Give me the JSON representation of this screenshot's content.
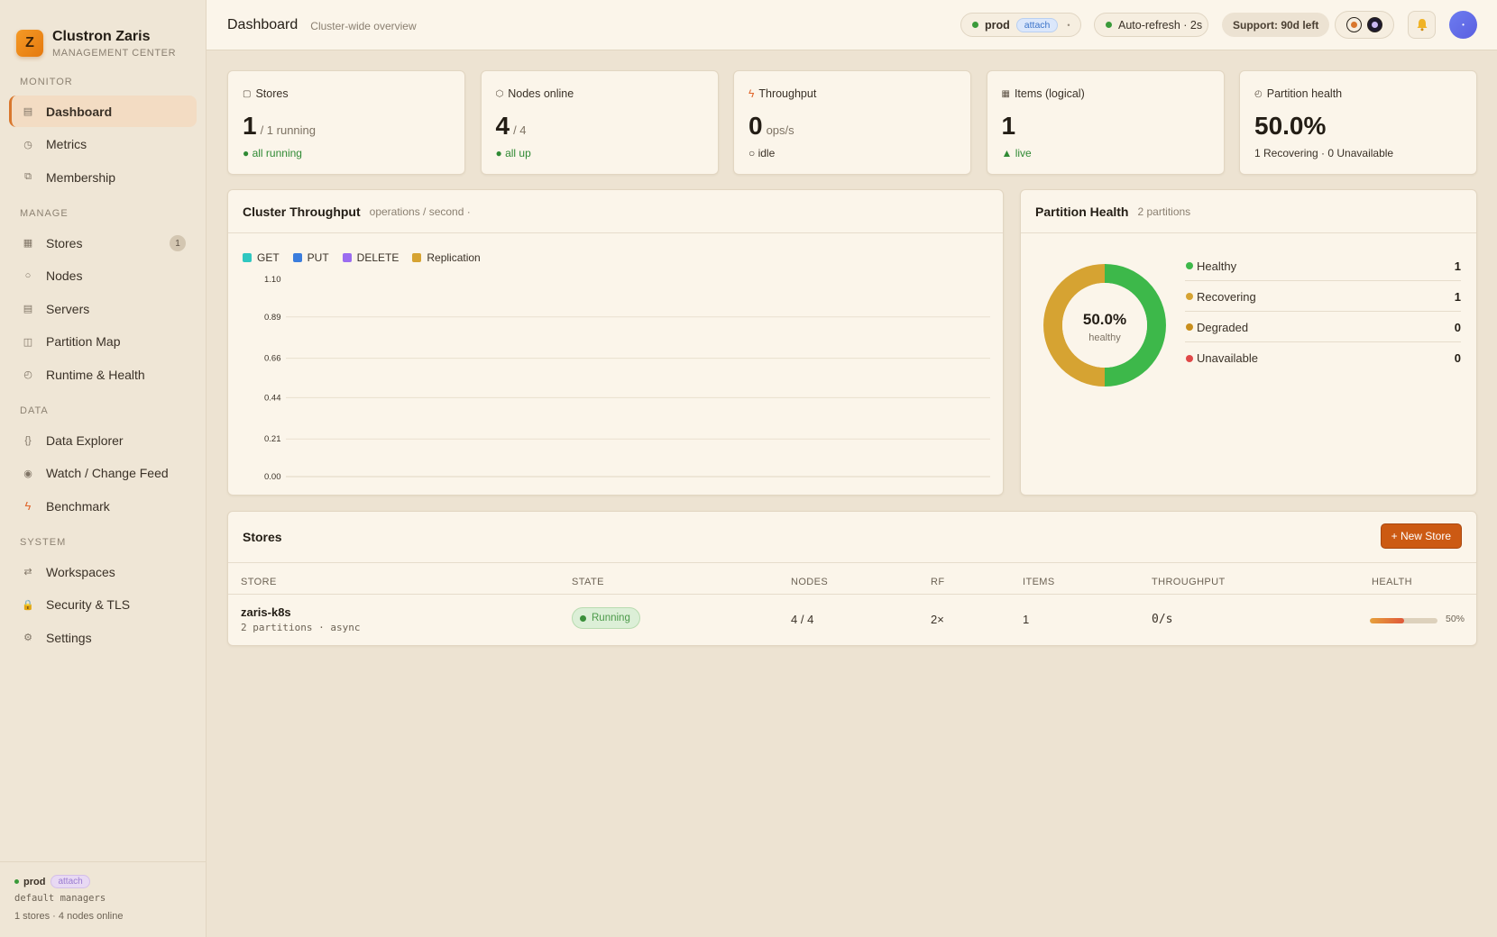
{
  "brand": {
    "logo": "Z",
    "name": "Clustron Zaris",
    "subtitle": "MANAGEMENT CENTER"
  },
  "sidebar": {
    "sections": [
      {
        "label": "MONITOR",
        "items": [
          {
            "label": "Dashboard",
            "icon": "grid-icon",
            "active": true
          },
          {
            "label": "Metrics",
            "icon": "gauge-icon"
          },
          {
            "label": "Membership",
            "icon": "people-icon"
          }
        ]
      },
      {
        "label": "MANAGE",
        "items": [
          {
            "label": "Stores",
            "icon": "database-icon",
            "badge": "1"
          },
          {
            "label": "Nodes",
            "icon": "node-icon"
          },
          {
            "label": "Servers",
            "icon": "server-icon"
          },
          {
            "label": "Partition Map",
            "icon": "map-icon"
          },
          {
            "label": "Runtime & Health",
            "icon": "heartbeat-icon"
          }
        ]
      },
      {
        "label": "DATA",
        "items": [
          {
            "label": "Data Explorer",
            "icon": "braces-icon"
          },
          {
            "label": "Watch / Change Feed",
            "icon": "eye-icon"
          },
          {
            "label": "Benchmark",
            "icon": "bolt-icon"
          }
        ]
      },
      {
        "label": "SYSTEM",
        "items": [
          {
            "label": "Workspaces",
            "icon": "swap-icon"
          },
          {
            "label": "Security & TLS",
            "icon": "lock-icon"
          },
          {
            "label": "Settings",
            "icon": "gear-icon"
          }
        ]
      }
    ],
    "footer": {
      "env": "prod",
      "attach": "attach",
      "workspace": "default managers",
      "summary": "1 stores · 4 nodes online"
    }
  },
  "header": {
    "title": "Dashboard",
    "subtitle": "Cluster-wide overview",
    "env": "prod",
    "attach": "attach",
    "env_caret": "•",
    "autorefresh": "Auto-refresh · 2s",
    "support": "Support: 90d left",
    "avatar": "•"
  },
  "stats": [
    {
      "label": "Stores",
      "icon": "square-icon",
      "value": "1",
      "suffix": "/ 1 running",
      "foot": "● all running",
      "foot_status": "green"
    },
    {
      "label": "Nodes online",
      "icon": "hexagon-icon",
      "value": "4",
      "suffix": "/ 4",
      "foot": "● all up",
      "foot_status": "green"
    },
    {
      "label": "Throughput",
      "icon": "bolt-icon",
      "value": "0",
      "suffix": "ops/s",
      "foot": "○ idle",
      "foot_status": "neutral"
    },
    {
      "label": "Items (logical)",
      "icon": "table-icon",
      "value": "1",
      "suffix": "",
      "foot": "▲ live",
      "foot_status": "green"
    },
    {
      "label": "Partition health",
      "icon": "pie-icon",
      "value": "50.0%",
      "suffix": "",
      "foot": "1 Recovering · 0 Unavailable",
      "foot_status": "neutral"
    }
  ],
  "throughput": {
    "title": "Cluster Throughput",
    "meta": "operations / second ·"
  },
  "chart_data": {
    "type": "line",
    "title": "Cluster Throughput",
    "ylabel": "",
    "xlabel": "",
    "ylim": [
      0,
      1.1
    ],
    "yticks": [
      "1.10",
      "0.89",
      "0.66",
      "0.44",
      "0.21",
      "0.00"
    ],
    "grid": true,
    "legend_position": "top-left",
    "series": [
      {
        "name": "GET",
        "color": "#2fc7c0",
        "values": []
      },
      {
        "name": "PUT",
        "color": "#3b7ddd",
        "values": []
      },
      {
        "name": "DELETE",
        "color": "#9b6cf0",
        "values": []
      },
      {
        "name": "Replication",
        "color": "#d6a332",
        "values": []
      }
    ]
  },
  "partition_health": {
    "title": "Partition Health",
    "meta": "2 partitions",
    "center_value": "50.0%",
    "center_label": "healthy",
    "segments": [
      {
        "label": "Healthy",
        "count": 1,
        "color": "#3db84a"
      },
      {
        "label": "Recovering",
        "count": 1,
        "color": "#d6a332"
      },
      {
        "label": "Degraded",
        "count": 0,
        "color": "#c98f1d"
      },
      {
        "label": "Unavailable",
        "count": 0,
        "color": "#e04848"
      }
    ]
  },
  "stores": {
    "title": "Stores",
    "new_button": "+ New Store",
    "columns": [
      "STORE",
      "STATE",
      "NODES",
      "RF",
      "ITEMS",
      "THROUGHPUT",
      "HEALTH"
    ],
    "rows": [
      {
        "name": "zaris-k8s",
        "detail": "2 partitions · async",
        "state": "Running",
        "nodes": "4 / 4",
        "rf": "2×",
        "items": "1",
        "throughput": "0/s",
        "health": 0.5,
        "health_label": "50%"
      }
    ]
  }
}
